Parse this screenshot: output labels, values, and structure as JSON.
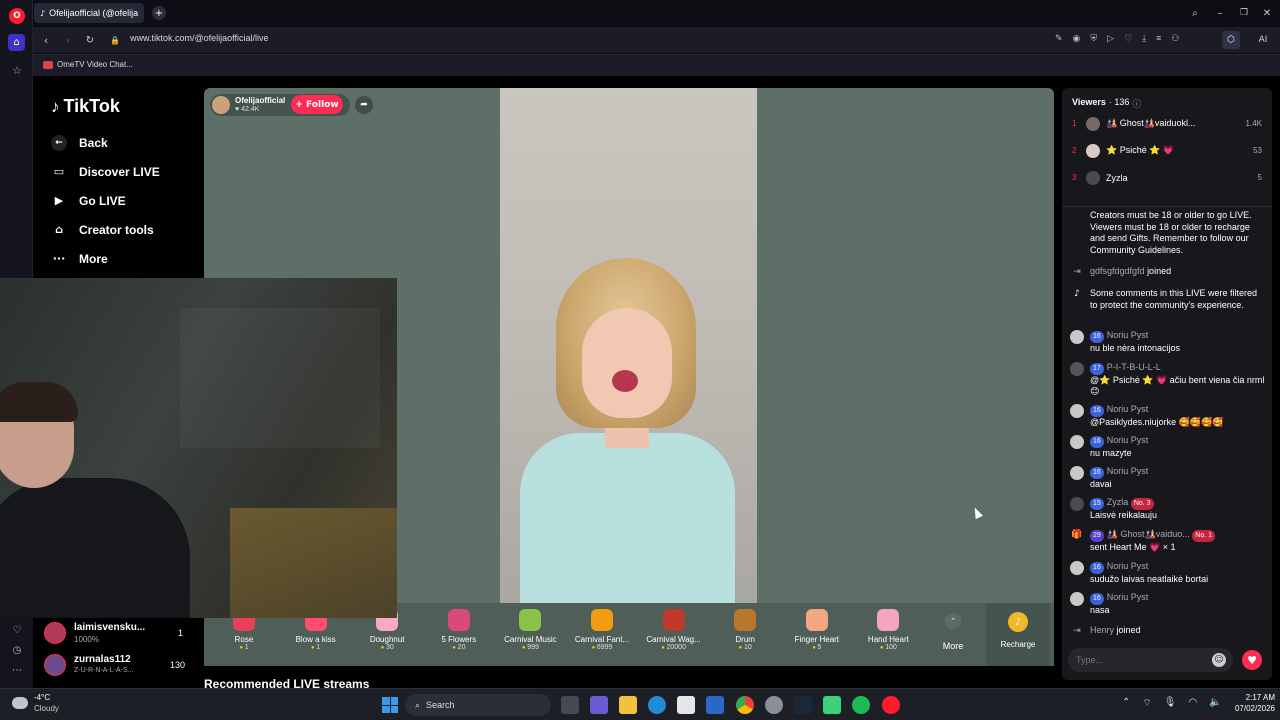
{
  "browser": {
    "tab_title": "Ofelijaofficial (@ofelija",
    "url": "www.tiktok.com/@ofelijaofficial/live",
    "bookmark": "OmeTV Video Chat..."
  },
  "nav": {
    "logo": "TikTok",
    "items": [
      {
        "label": "Back",
        "icon": "arrow-left-icon"
      },
      {
        "label": "Discover LIVE",
        "icon": "live-tv-icon"
      },
      {
        "label": "Go LIVE",
        "icon": "camera-icon"
      },
      {
        "label": "Creator tools",
        "icon": "house-icon"
      },
      {
        "label": "More",
        "icon": "ellipsis-icon"
      }
    ]
  },
  "streamer": {
    "name": "Ofelijaofficial",
    "likes": "42.4K",
    "follow_label": "+ Follow"
  },
  "gifts": [
    {
      "name": "Rose",
      "cost": "1",
      "color": "#e8415a"
    },
    {
      "name": "Blow a kiss",
      "cost": "1",
      "color": "#ff4d6d"
    },
    {
      "name": "Doughnut",
      "cost": "30",
      "color": "#f7a9c4"
    },
    {
      "name": "5 Flowers",
      "cost": "20",
      "color": "#d94a78"
    },
    {
      "name": "Carnival Music",
      "cost": "999",
      "color": "#8bc34a"
    },
    {
      "name": "Carnival Fant...",
      "cost": "6999",
      "color": "#f39c12"
    },
    {
      "name": "Carnival Wag...",
      "cost": "20000",
      "color": "#c0392b"
    },
    {
      "name": "Drum",
      "cost": "10",
      "color": "#b9772e"
    },
    {
      "name": "Finger Heart",
      "cost": "5",
      "color": "#f4a582"
    },
    {
      "name": "Hand Heart",
      "cost": "100",
      "color": "#f5a3c0"
    }
  ],
  "gift_more_label": "More",
  "recharge_label": "Recharge",
  "recommended_label": "Recommended LIVE streams",
  "left_list": [
    {
      "name": "laimisvensku...",
      "sub": "1000%",
      "count": "1"
    },
    {
      "name": "zurnalas112",
      "sub": "Z-U-R-N-A-L-A-S...",
      "count": "130"
    }
  ],
  "viewers": {
    "title": "Viewers",
    "count": "· 136",
    "top": [
      {
        "rank": "1",
        "name": "🎎 Ghost🎎vaiduokl...",
        "score": "1.4K"
      },
      {
        "rank": "2",
        "name": "⭐ Psichė ⭐ 💗",
        "score": "53"
      },
      {
        "rank": "3",
        "name": "Zyzla",
        "score": "5"
      }
    ]
  },
  "chat": [
    {
      "type": "sys",
      "text": "Creators must be 18 or older to go LIVE. Viewers must be 18 or older to recharge and send Gifts. Remember to follow our Community Guidelines."
    },
    {
      "type": "join",
      "user": "gdfsgfdgdfgfd",
      "text": "joined"
    },
    {
      "type": "sys2",
      "text": "Some comments in this LIVE were filtered to protect the community's experience."
    },
    {
      "type": "msg",
      "badge": "16",
      "user": "Noriu Pyst",
      "text": "nu ble nėra intonacijos"
    },
    {
      "type": "msg",
      "badge": "17",
      "user": "P-I-T-B-U-L-L",
      "text": "@⭐ Psichė ⭐ 💗 ačiu bent viena čia nrml😊"
    },
    {
      "type": "msg",
      "badge": "16",
      "user": "Noriu Pyst",
      "text": "@Pasiklydes.niujorke 🥰🥰🥰🥰"
    },
    {
      "type": "msg",
      "badge": "16",
      "user": "Noriu Pyst",
      "text": "nu mazyte"
    },
    {
      "type": "msg",
      "badge": "16",
      "user": "Noriu Pyst",
      "text": "davai"
    },
    {
      "type": "msg",
      "badge": "15",
      "user": "Zyzla",
      "tag": "No. 3",
      "text": "Laisvė reikalauju"
    },
    {
      "type": "msg",
      "badge": "29",
      "user": "🎎 Ghost🎎vaiduo...",
      "tag": "No. 1",
      "text": "sent Heart Me 💗 × 1"
    },
    {
      "type": "msg",
      "badge": "16",
      "user": "Noriu Pyst",
      "text": "sudužo laivas neatlaikė bortai"
    },
    {
      "type": "msg",
      "badge": "16",
      "user": "Noriu Pyst",
      "text": "nasa"
    },
    {
      "type": "join",
      "user": "Henry",
      "text": "joined"
    }
  ],
  "chat_placeholder": "Type...",
  "taskbar": {
    "weather_temp": "-4°C",
    "weather_desc": "Cloudy",
    "search_label": "Search",
    "time": "2:17 AM",
    "date": "07/02/2026"
  }
}
